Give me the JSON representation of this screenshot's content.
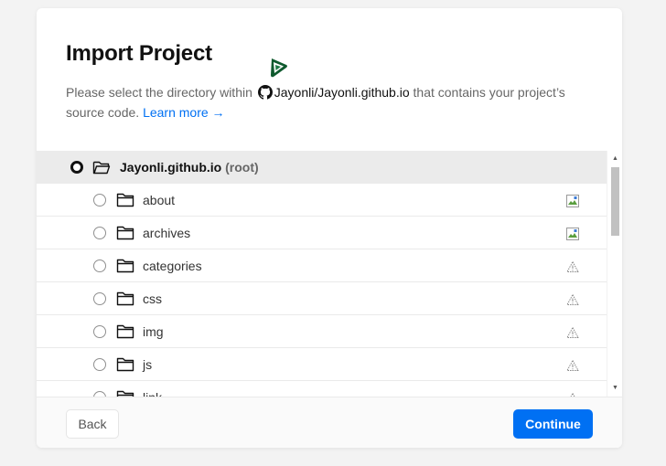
{
  "dialog": {
    "title": "Import Project",
    "description_prefix": "Please select the directory within ",
    "repo": "Jayonli/Jayonli.github.io",
    "description_suffix": " that contains your project’s source code. ",
    "learn_more": "Learn more →"
  },
  "tree": {
    "root": {
      "name": "Jayonli.github.io",
      "suffix": "(root)",
      "selected": true
    },
    "items": [
      {
        "name": "about",
        "status_icon": "broken-image-icon"
      },
      {
        "name": "archives",
        "status_icon": "broken-image-icon"
      },
      {
        "name": "categories",
        "status_icon": "warning-icon"
      },
      {
        "name": "css",
        "status_icon": "warning-icon"
      },
      {
        "name": "img",
        "status_icon": "warning-icon"
      },
      {
        "name": "js",
        "status_icon": "warning-icon"
      },
      {
        "name": "link",
        "status_icon": "warning-icon"
      }
    ]
  },
  "footer": {
    "back_label": "Back",
    "continue_label": "Continue"
  },
  "colors": {
    "accent": "#0070f3",
    "background": "#f3f3f3",
    "root_row": "#ebebeb"
  }
}
